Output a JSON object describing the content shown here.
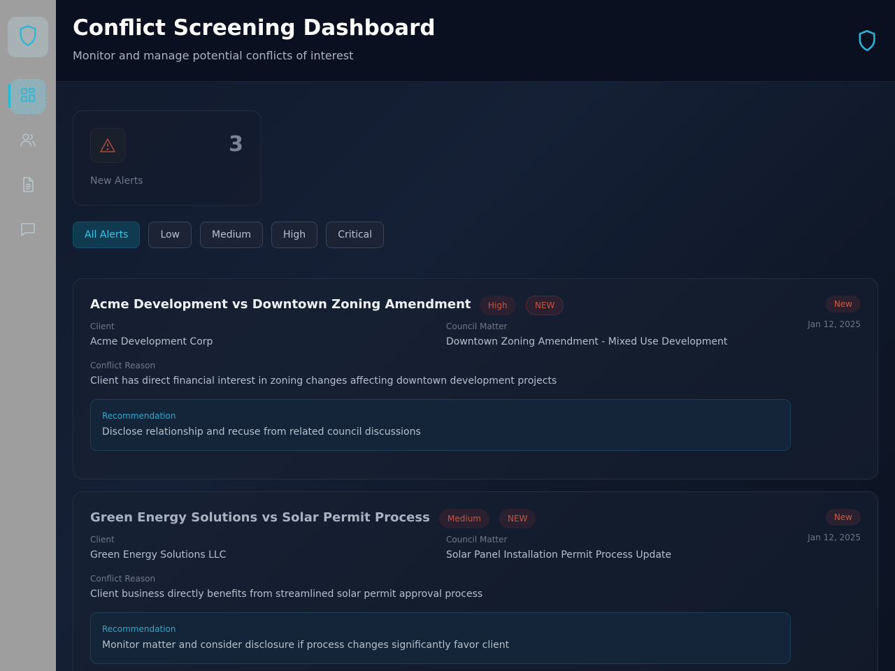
{
  "header": {
    "title": "Conflict Screening Dashboard",
    "subtitle": "Monitor and manage potential conflicts of interest"
  },
  "sidebar": {
    "items": [
      {
        "icon": "dashboard-icon",
        "active": true
      },
      {
        "icon": "users-icon",
        "active": false
      },
      {
        "icon": "document-icon",
        "active": false
      },
      {
        "icon": "chat-icon",
        "active": false
      }
    ]
  },
  "stats": {
    "new_alerts_value": "3",
    "new_alerts_label": "New Alerts"
  },
  "filters": [
    "All Alerts",
    "Low",
    "Medium",
    "High",
    "Critical"
  ],
  "active_filter": "All Alerts",
  "alerts": [
    {
      "title": "Acme Development vs Downtown Zoning Amendment",
      "severity": "High",
      "new_badge": "NEW",
      "status": "New",
      "date": "Jan 12, 2025",
      "client_label": "Client",
      "client": "Acme Development Corp",
      "matter_label": "Council Matter",
      "matter": "Downtown Zoning Amendment - Mixed Use Development",
      "reason_label": "Conflict Reason",
      "reason": "Client has direct financial interest in zoning changes affecting downtown development projects",
      "rec_label": "Recommendation",
      "recommendation": "Disclose relationship and recuse from related council discussions"
    },
    {
      "title": "Green Energy Solutions vs Solar Permit Process",
      "severity": "Medium",
      "new_badge": "NEW",
      "status": "New",
      "date": "Jan 12, 2025",
      "client_label": "Client",
      "client": "Green Energy Solutions LLC",
      "matter_label": "Council Matter",
      "matter": "Solar Panel Installation Permit Process Update",
      "reason_label": "Conflict Reason",
      "reason": "Client business directly benefits from streamlined solar permit approval process",
      "rec_label": "Recommendation",
      "recommendation": "Monitor matter and consider disclosure if process changes significantly favor client"
    }
  ],
  "colors": {
    "accent": "#22b8d8",
    "alert_red": "#c7553f",
    "background": "#0f1626"
  }
}
